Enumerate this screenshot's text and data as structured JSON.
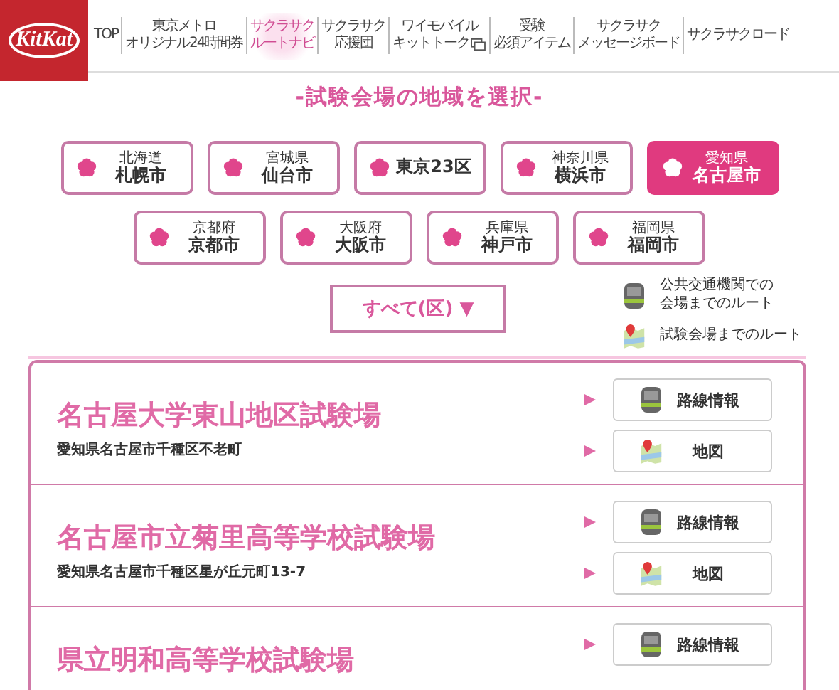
{
  "logo": {
    "text": "KitKat"
  },
  "nav": [
    {
      "lines": [
        "TOP"
      ],
      "selected": false,
      "window_icon": false
    },
    {
      "lines": [
        "東京メトロ",
        "オリジナル24時間券"
      ],
      "selected": false,
      "window_icon": false
    },
    {
      "lines": [
        "サクラサク",
        "ルートナビ"
      ],
      "selected": true,
      "window_icon": false
    },
    {
      "lines": [
        "サクラサク",
        "応援団"
      ],
      "selected": false,
      "window_icon": false
    },
    {
      "lines": [
        "ワイモバイル",
        "キットトーク"
      ],
      "selected": false,
      "window_icon": true
    },
    {
      "lines": [
        "受験",
        "必須アイテム"
      ],
      "selected": false,
      "window_icon": false
    },
    {
      "lines": [
        "サクラサク",
        "メッセージボード"
      ],
      "selected": false,
      "window_icon": false
    },
    {
      "lines": [
        "サクラサクロード"
      ],
      "selected": false,
      "window_icon": false
    }
  ],
  "heading": "-試験会場の地域を選択-",
  "regions": [
    [
      {
        "prefecture": "北海道",
        "city": "札幌市",
        "selected": false
      },
      {
        "prefecture": "宮城県",
        "city": "仙台市",
        "selected": false
      },
      {
        "city": "東京23区",
        "selected": false
      },
      {
        "prefecture": "神奈川県",
        "city": "横浜市",
        "selected": false
      },
      {
        "prefecture": "愛知県",
        "city": "名古屋市",
        "selected": true
      }
    ],
    [
      {
        "prefecture": "京都府",
        "city": "京都市",
        "selected": false
      },
      {
        "prefecture": "大阪府",
        "city": "大阪市",
        "selected": false
      },
      {
        "prefecture": "兵庫県",
        "city": "神戸市",
        "selected": false
      },
      {
        "prefecture": "福岡県",
        "city": "福岡市",
        "selected": false
      }
    ]
  ],
  "filter": {
    "label": "すべて(区) ▼"
  },
  "legend": [
    {
      "kind": "train",
      "lines": [
        "公共交通機関での",
        "会場までのルート"
      ]
    },
    {
      "kind": "map",
      "lines": [
        "試験会場までのルート"
      ]
    }
  ],
  "venues": [
    {
      "name": "名古屋大学東山地区試験場",
      "address": "愛知県名古屋市千種区不老町",
      "links": [
        {
          "kind": "train",
          "label": "路線情報"
        },
        {
          "kind": "map",
          "label": "地図"
        }
      ]
    },
    {
      "name": "名古屋市立菊里高等学校試験場",
      "address": "愛知県名古屋市千種区星が丘元町13-7",
      "links": [
        {
          "kind": "train",
          "label": "路線情報"
        },
        {
          "kind": "map",
          "label": "地図"
        }
      ]
    },
    {
      "name": "県立明和高等学校試験場",
      "links": [
        {
          "kind": "train",
          "label": "路線情報"
        }
      ]
    }
  ]
}
